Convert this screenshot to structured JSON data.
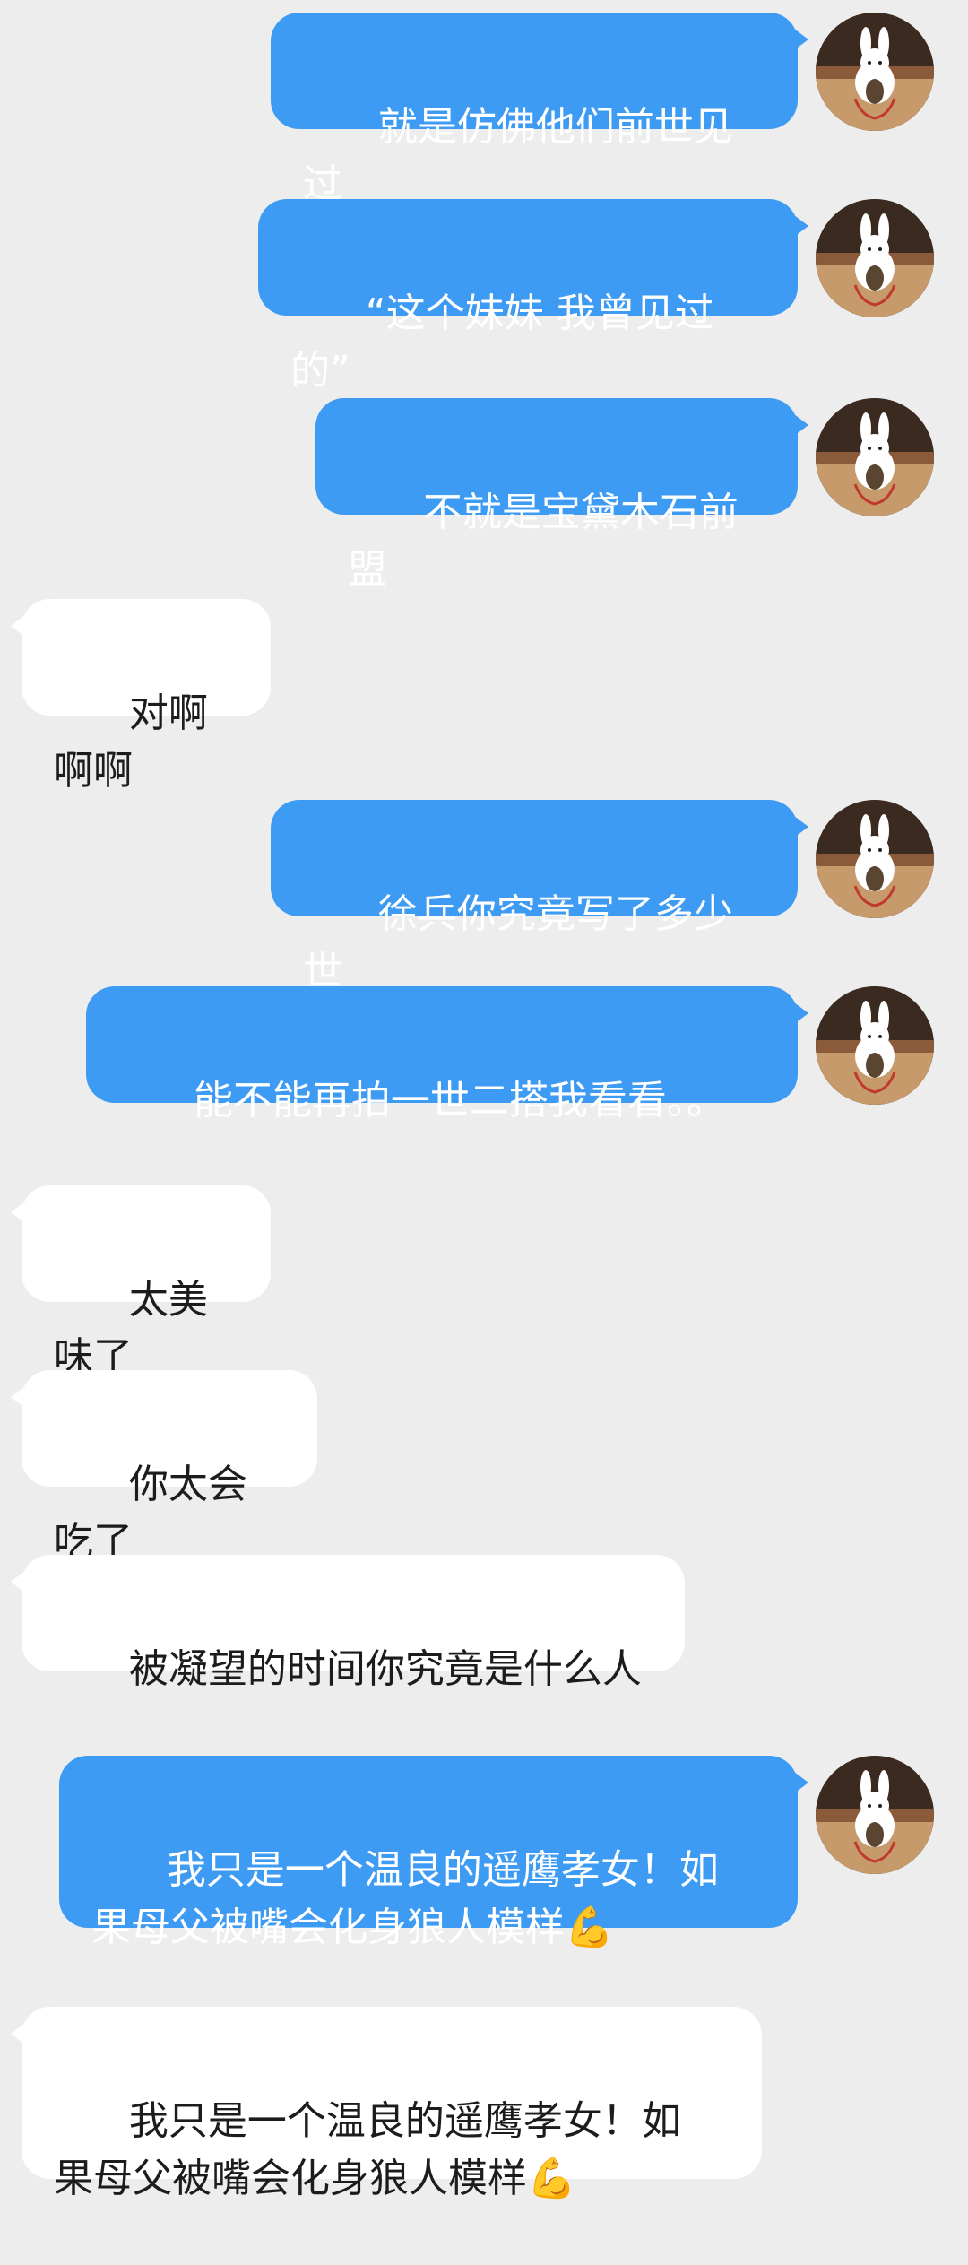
{
  "messages": [
    {
      "sender": "me",
      "text": "就是仿佛他们前世见过"
    },
    {
      "sender": "me",
      "text": "“这个妹妹 我曾见过的”"
    },
    {
      "sender": "me",
      "text": "不就是宝黛木石前盟"
    },
    {
      "sender": "other",
      "text": "对啊啊啊"
    },
    {
      "sender": "me",
      "text": "徐兵你究竟写了多少世"
    },
    {
      "sender": "me",
      "text": "能不能再拍一世二搭我看看。。"
    },
    {
      "sender": "other",
      "text": "太美味了"
    },
    {
      "sender": "other",
      "text": "你太会吃了"
    },
    {
      "sender": "other",
      "text": "被凝望的时间你究竟是什么人"
    },
    {
      "sender": "me",
      "text": "我只是一个温良的遥鹰孝女！如\n果母父被嘴会化身狼人模样💪"
    },
    {
      "sender": "other",
      "text": "我只是一个温良的遥鹰孝女！如\n果母父被嘴会化身狼人模样💪"
    }
  ],
  "avatar": {
    "icon": "bunny-plush-avatar-icon"
  }
}
